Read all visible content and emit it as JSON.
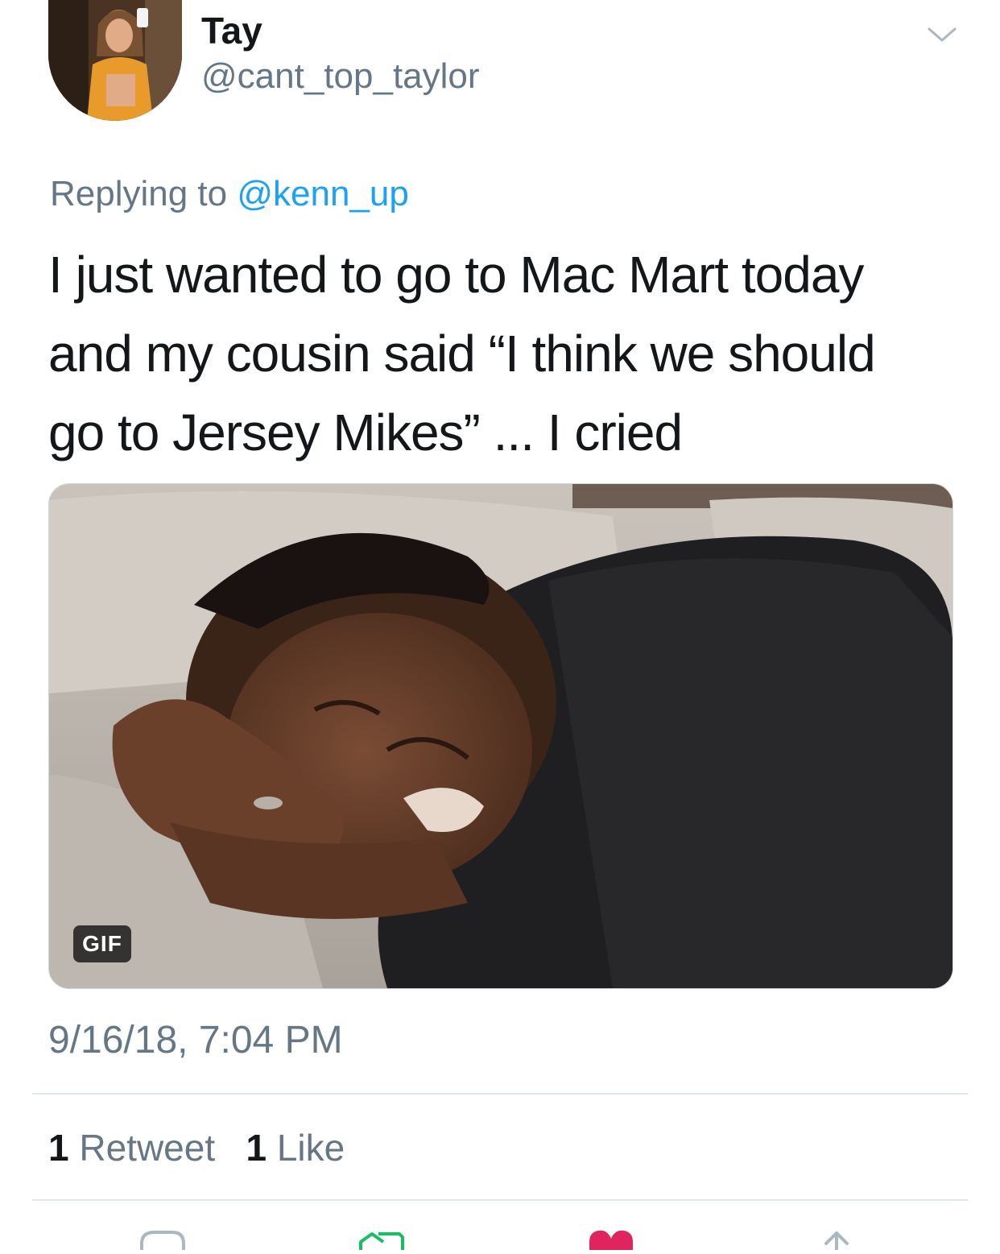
{
  "author": {
    "display_name": "Tay",
    "handle": "@cant_top_taylor"
  },
  "reply": {
    "prefix": "Replying to",
    "mention": "@kenn_up"
  },
  "tweet": {
    "text_lines": [
      "I just wanted to go to Mac Mart today",
      "and my cousin said “I think we should",
      "go to Jersey Mikes” ... I cried"
    ],
    "media_badge": "GIF",
    "timestamp": "9/16/18, 7:04 PM"
  },
  "stats": {
    "retweet_count": "1",
    "retweet_label": "Retweet",
    "like_count": "1",
    "like_label": "Like"
  },
  "icons": {
    "menu": "chevron-down-icon",
    "reply": "reply-icon",
    "retweet": "retweet-icon",
    "like": "heart-icon",
    "share": "share-icon"
  },
  "colors": {
    "link": "#1da1f2",
    "secondary_text": "#657786",
    "retweet_green": "#17bf63",
    "like_red": "#e0245e"
  }
}
